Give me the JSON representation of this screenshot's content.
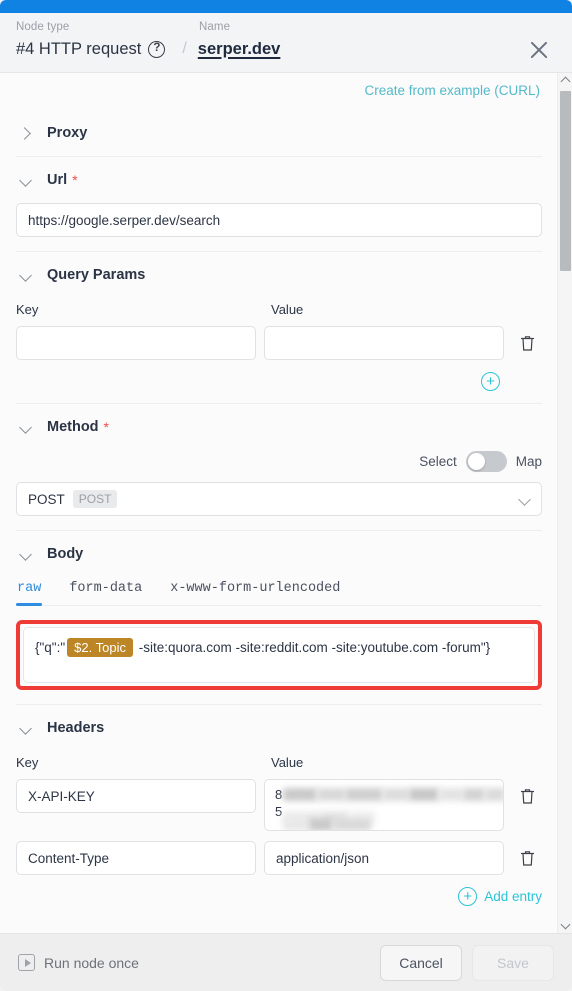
{
  "header": {
    "node_type_label": "Node type",
    "node_type_value": "#4 HTTP request",
    "help_icon": "question-circle-icon",
    "separator": "/",
    "name_label": "Name",
    "node_name": "serper.dev",
    "close_icon": "close-icon"
  },
  "toolbar": {
    "curl_link": "Create from example (CURL)"
  },
  "sections": {
    "proxy": {
      "title": "Proxy",
      "expanded": false
    },
    "url": {
      "title": "Url",
      "required": "*",
      "value": "https://google.serper.dev/search",
      "placeholder": ""
    },
    "query_params": {
      "title": "Query Params",
      "key_label": "Key",
      "value_label": "Value",
      "rows": [
        {
          "key": "",
          "value": "",
          "key_placeholder": "",
          "value_placeholder": ""
        }
      ],
      "add_icon": "plus-circle-icon",
      "delete_icon": "trash-icon"
    },
    "method": {
      "title": "Method",
      "required": "*",
      "toggle_left_label": "Select",
      "toggle_right_label": "Map",
      "toggle_on": false,
      "selected": "POST",
      "selected_chip": "POST",
      "caret_icon": "chevron-down-icon"
    },
    "body": {
      "title": "Body",
      "tabs": [
        {
          "label": "raw",
          "active": true
        },
        {
          "label": "form-data",
          "active": false
        },
        {
          "label": "x-www-form-urlencoded",
          "active": false
        }
      ],
      "editor_prefix": "{\"q\":\"",
      "editor_chip": "$2. Topic",
      "editor_suffix": " -site:quora.com -site:reddit.com -site:youtube.com -forum\"}",
      "highlighted": true,
      "highlight_color": "#ef3b36",
      "chip_color": "#bc8526"
    },
    "headers": {
      "title": "Headers",
      "key_label": "Key",
      "value_label": "Value",
      "rows": [
        {
          "key": "X-API-KEY",
          "value": "",
          "value_redacted": true,
          "value_first_char_line1": "8",
          "value_first_char_line2": "5"
        },
        {
          "key": "Content-Type",
          "value": "application/json",
          "value_redacted": false
        }
      ],
      "add_entry_label": "Add entry",
      "add_entry_icon": "plus-circle-icon",
      "delete_icon": "trash-icon"
    }
  },
  "scrollbar": {
    "up_icon": "scroll-up-arrow-icon",
    "down_icon": "scroll-down-arrow-icon"
  },
  "footer": {
    "run_label": "Run node once",
    "run_icon": "play-icon",
    "cancel_label": "Cancel",
    "save_label": "Save",
    "save_disabled": true
  },
  "colors": {
    "accent_blue": "#0f82e3",
    "link_teal": "#2bc4d8",
    "curl_link": "#55b9c9",
    "tab_active": "#2f8ce0",
    "required_red": "#f04b4b",
    "highlight_red": "#ef3b36",
    "expression_chip": "#bc8526"
  }
}
